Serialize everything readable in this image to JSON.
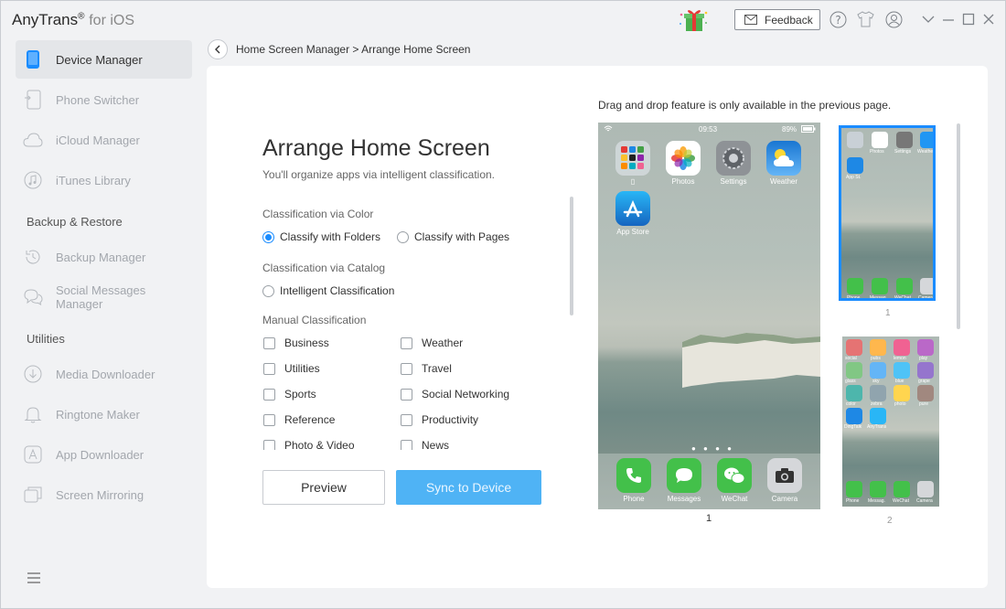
{
  "app": {
    "brand": "AnyTrans",
    "reg": "®",
    "brand_suffix": "for iOS"
  },
  "toolbar": {
    "feedback_label": "Feedback"
  },
  "sidebar": {
    "items": [
      {
        "label": "Device Manager"
      },
      {
        "label": "Phone Switcher"
      },
      {
        "label": "iCloud Manager"
      },
      {
        "label": "iTunes Library"
      },
      {
        "label": "Backup Manager"
      },
      {
        "label": "Social Messages Manager"
      },
      {
        "label": "Media Downloader"
      },
      {
        "label": "Ringtone Maker"
      },
      {
        "label": "App Downloader"
      },
      {
        "label": "Screen Mirroring"
      }
    ],
    "sections": {
      "backup": "Backup & Restore",
      "utilities": "Utilities"
    }
  },
  "breadcrumb": {
    "text": "Home Screen Manager > Arrange Home Screen"
  },
  "main": {
    "title": "Arrange Home Screen",
    "subtitle": "You'll organize apps via intelligent classification.",
    "color_group": "Classification via Color",
    "color_options": [
      "Classify with Folders",
      "Classify with Pages"
    ],
    "catalog_group": "Classification via Catalog",
    "catalog_option": "Intelligent Classification",
    "manual_group": "Manual Classification",
    "manual_left": [
      "Business",
      "Utilities",
      "Sports",
      "Reference",
      "Photo & Video"
    ],
    "manual_right": [
      "Weather",
      "Travel",
      "Social Networking",
      "Productivity",
      "News"
    ],
    "preview_label": "Preview",
    "sync_label": "Sync to Device",
    "drag_note": "Drag and drop feature is only available in the previous page."
  },
  "phone": {
    "time": "09:53",
    "battery": "89%",
    "apps": [
      "Photos",
      "Settings",
      "Weather",
      "App Store"
    ],
    "dock": [
      "Phone",
      "Messages",
      "WeChat",
      "Camera"
    ],
    "page_number": "1"
  },
  "thumbs": {
    "page1": {
      "number": "1",
      "labels": [
        "Photos",
        "Settings",
        "Weather",
        "App St.",
        "Phone",
        "Messag.",
        "WeChat",
        "Camera"
      ]
    },
    "page2": {
      "number": "2",
      "labels": [
        "social",
        "pubs",
        "lemon",
        "play",
        "glass",
        "sky",
        "blue",
        "grape",
        "color",
        "zebra",
        "photo",
        "pure",
        "DingTalk",
        "AnyTrans",
        "Phone",
        "Messag.",
        "WeChat",
        "Camera"
      ]
    }
  },
  "colors": {
    "accent": "#1a8cff",
    "sync_button": "#4fb3f5",
    "thumb_selected_border": "#1a8cff"
  }
}
